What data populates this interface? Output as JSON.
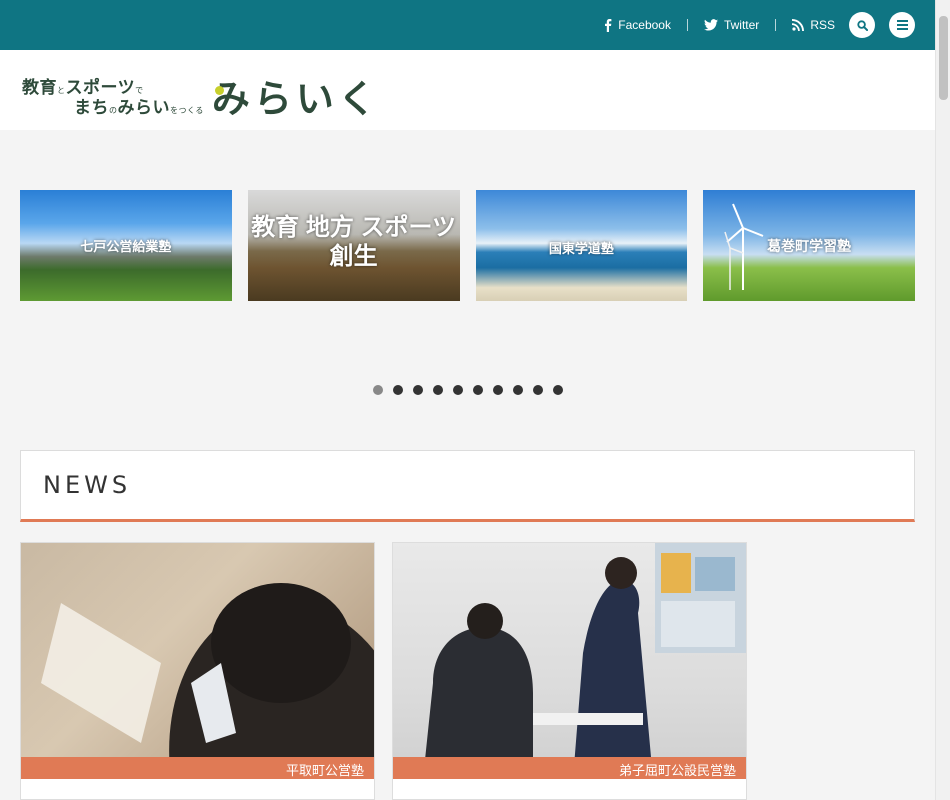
{
  "topbar": {
    "facebook_label": "Facebook",
    "twitter_label": "Twitter",
    "rss_label": "RSS"
  },
  "logo": {
    "line1_a": "教育",
    "line1_small1": "と",
    "line1_b": "スポーツ",
    "line1_small2": "で",
    "line2_a": "まち",
    "line2_small1": "の",
    "line2_b": "みらい",
    "line2_small2": "をつくる",
    "big": "みらいく"
  },
  "slider": {
    "slides": [
      {
        "caption": "七戸公営給業塾"
      },
      {
        "caption": "教育 地方 スポーツ 創生"
      },
      {
        "caption": "国東学道塾"
      },
      {
        "caption": "葛巻町学習塾"
      }
    ],
    "dot_count": 10,
    "active_dot": 1
  },
  "news": {
    "title": "NEWS",
    "cards": [
      {
        "tag": "平取町公営塾"
      },
      {
        "tag": "弟子屈町公設民営塾"
      }
    ]
  },
  "colors": {
    "topbar": "#0f7583",
    "accent": "#e07a55",
    "logo_text": "#2e4a3a"
  }
}
